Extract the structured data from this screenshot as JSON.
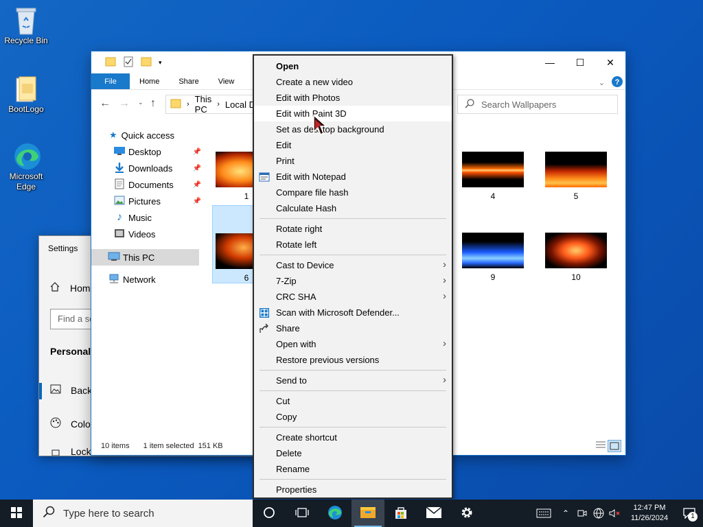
{
  "desktop": {
    "icons": [
      {
        "label": "Recycle Bin",
        "icon": "recycle-bin-icon"
      },
      {
        "label": "BootLogo",
        "icon": "folder-icon"
      },
      {
        "label": "Microsoft Edge",
        "icon": "edge-icon"
      }
    ]
  },
  "settings": {
    "title": "Settings",
    "home_label": "Home",
    "find_placeholder": "Find a setting",
    "section_title": "Personalization",
    "nav": [
      {
        "label": "Background",
        "icon": "picture-icon"
      },
      {
        "label": "Colors",
        "icon": "palette-icon"
      },
      {
        "label": "Lock screen",
        "icon": "lock-icon"
      }
    ]
  },
  "explorer": {
    "ribbon_tabs": [
      "File",
      "Home",
      "Share",
      "View"
    ],
    "breadcrumb": [
      "This PC",
      "Local Disk (C:)"
    ],
    "search_placeholder": "Search Wallpapers",
    "nav_pane": {
      "quick_access": "Quick access",
      "items": [
        {
          "label": "Desktop",
          "icon": "desktop-icon",
          "pinned": true
        },
        {
          "label": "Downloads",
          "icon": "download-icon",
          "pinned": true
        },
        {
          "label": "Documents",
          "icon": "document-icon",
          "pinned": true
        },
        {
          "label": "Pictures",
          "icon": "pictures-icon",
          "pinned": true
        },
        {
          "label": "Music",
          "icon": "music-icon",
          "pinned": false
        },
        {
          "label": "Videos",
          "icon": "video-icon",
          "pinned": false
        }
      ],
      "this_pc": "This PC",
      "network": "Network"
    },
    "files": [
      {
        "name": "1",
        "style": "fire-orange"
      },
      {
        "name": "4",
        "style": "fire-wave"
      },
      {
        "name": "5",
        "style": "fire-low"
      },
      {
        "name": "6",
        "style": "fire-figure"
      },
      {
        "name": "9",
        "style": "fire-blue"
      },
      {
        "name": "10",
        "style": "fire-horse"
      }
    ],
    "status": {
      "items": "10 items",
      "selected": "1 item selected",
      "size": "151 KB"
    }
  },
  "context_menu": {
    "items": [
      {
        "label": "Open",
        "bold": true
      },
      {
        "label": "Create a new video"
      },
      {
        "label": "Edit with Photos"
      },
      {
        "label": "Edit with Paint 3D",
        "hover": true
      },
      {
        "label": "Set as desktop background"
      },
      {
        "label": "Edit"
      },
      {
        "label": "Print"
      },
      {
        "label": "Edit with Notepad",
        "icon": "notepad-icon"
      },
      {
        "label": "Compare file hash"
      },
      {
        "label": "Calculate Hash"
      },
      {
        "sep": true
      },
      {
        "label": "Rotate right"
      },
      {
        "label": "Rotate left"
      },
      {
        "sep": true
      },
      {
        "label": "Cast to Device",
        "submenu": true
      },
      {
        "label": "7-Zip",
        "submenu": true
      },
      {
        "label": "CRC SHA",
        "submenu": true
      },
      {
        "label": "Scan with Microsoft Defender...",
        "icon": "defender-icon"
      },
      {
        "label": "Share",
        "icon": "share-icon"
      },
      {
        "label": "Open with",
        "submenu": true
      },
      {
        "label": "Restore previous versions"
      },
      {
        "sep": true
      },
      {
        "label": "Send to",
        "submenu": true
      },
      {
        "sep": true
      },
      {
        "label": "Cut"
      },
      {
        "label": "Copy"
      },
      {
        "sep": true
      },
      {
        "label": "Create shortcut"
      },
      {
        "label": "Delete"
      },
      {
        "label": "Rename"
      },
      {
        "sep": true
      },
      {
        "label": "Properties"
      }
    ]
  },
  "taskbar": {
    "search_placeholder": "Type here to search",
    "apps": [
      "cortana-icon",
      "task-view-icon",
      "edge-icon",
      "file-explorer-icon",
      "store-icon",
      "mail-icon",
      "settings-icon"
    ],
    "time": "12:47 PM",
    "date": "11/26/2024",
    "notification_count": "1"
  },
  "colors": {
    "accent": "#1979ca",
    "taskbar": "#141c26",
    "desktop": "#0b5bc0"
  }
}
